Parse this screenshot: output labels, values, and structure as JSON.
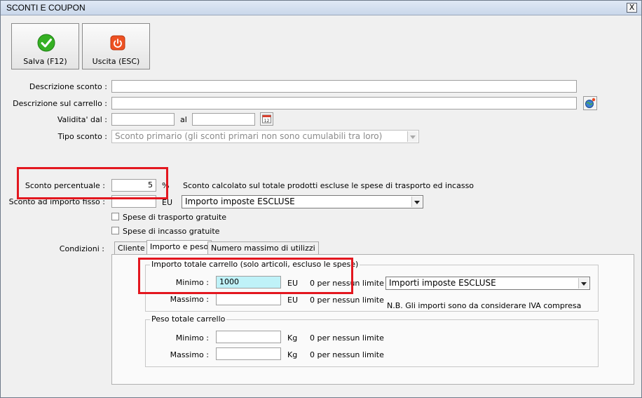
{
  "window": {
    "title": "SCONTI E COUPON",
    "close_label": "X"
  },
  "toolbar": {
    "save_label": "Salva (F12)",
    "exit_label": "Uscita (ESC)"
  },
  "form": {
    "descrizione_label": "Descrizione sconto :",
    "descrizione_value": "",
    "carrello_label": "Descrizione sul carrello :",
    "carrello_value": "",
    "validita_label": "Validita' dal :",
    "validita_dal": "",
    "al_label": "al",
    "validita_al": "",
    "tipo_label": "Tipo sconto :",
    "tipo_value": "Sconto primario (gli sconti primari non sono cumulabili tra loro)",
    "percentuale_label": "Sconto percentuale :",
    "percentuale_value": "5",
    "percent_unit": "%",
    "percentuale_note": "Sconto calcolato sul totale prodotti escluse le spese di trasporto ed incasso",
    "importo_label": "Sconto ad importo fisso :",
    "importo_value": "",
    "importo_unit": "EU",
    "importo_select": "Importo imposte ESCLUSE",
    "spese_trasporto_label": "Spese di trasporto gratuite",
    "spese_trasporto_checked": false,
    "spese_incasso_label": "Spese di incasso gratuite",
    "spese_incasso_checked": false,
    "condizioni_label": "Condizioni :"
  },
  "tabs": [
    {
      "label": "Cliente"
    },
    {
      "label": "Importo e peso"
    },
    {
      "label": "Numero massimo di utilizzi"
    }
  ],
  "active_tab": "Importo e peso",
  "importo_group": {
    "title": "Importo totale carrello (solo articoli, escluso le spese)",
    "minimo_label": "Minimo :",
    "minimo_value": "1000",
    "minimo_unit": "EU",
    "minimo_hint": "0 per nessun limite",
    "massimo_label": "Massimo :",
    "massimo_value": "",
    "massimo_unit": "EU",
    "massimo_hint": "0 per nessun limite",
    "select_value": "Importi imposte ESCLUSE",
    "note": "N.B. Gli importi sono da considerare IVA compresa"
  },
  "peso_group": {
    "title": "Peso totale carrello",
    "minimo_label": "Minimo :",
    "minimo_value": "",
    "minimo_unit": "Kg",
    "minimo_hint": "0 per nessun limite",
    "massimo_label": "Massimo :",
    "massimo_value": "",
    "massimo_unit": "Kg",
    "massimo_hint": "0 per nessun limite"
  },
  "colors": {
    "highlight": "#e3171f",
    "active_input": "#bff2f8",
    "save_icon": "#2ea31f",
    "exit_icon": "#e8481f"
  }
}
